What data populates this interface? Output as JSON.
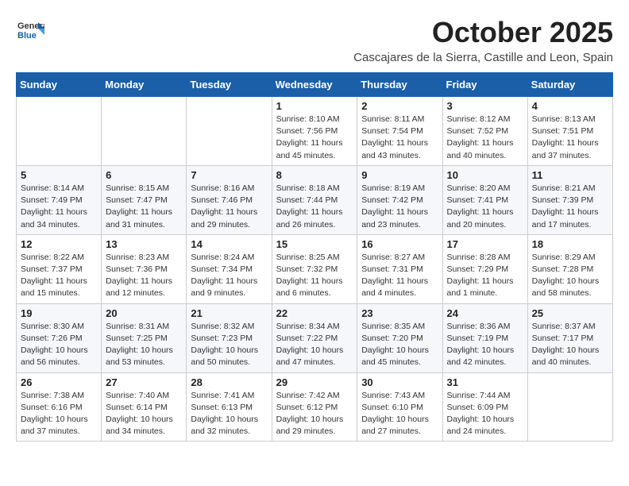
{
  "header": {
    "logo_line1": "General",
    "logo_line2": "Blue",
    "month": "October 2025",
    "location": "Cascajares de la Sierra, Castille and Leon, Spain"
  },
  "weekdays": [
    "Sunday",
    "Monday",
    "Tuesday",
    "Wednesday",
    "Thursday",
    "Friday",
    "Saturday"
  ],
  "weeks": [
    [
      {
        "day": "",
        "info": ""
      },
      {
        "day": "",
        "info": ""
      },
      {
        "day": "",
        "info": ""
      },
      {
        "day": "1",
        "info": "Sunrise: 8:10 AM\nSunset: 7:56 PM\nDaylight: 11 hours and 45 minutes."
      },
      {
        "day": "2",
        "info": "Sunrise: 8:11 AM\nSunset: 7:54 PM\nDaylight: 11 hours and 43 minutes."
      },
      {
        "day": "3",
        "info": "Sunrise: 8:12 AM\nSunset: 7:52 PM\nDaylight: 11 hours and 40 minutes."
      },
      {
        "day": "4",
        "info": "Sunrise: 8:13 AM\nSunset: 7:51 PM\nDaylight: 11 hours and 37 minutes."
      }
    ],
    [
      {
        "day": "5",
        "info": "Sunrise: 8:14 AM\nSunset: 7:49 PM\nDaylight: 11 hours and 34 minutes."
      },
      {
        "day": "6",
        "info": "Sunrise: 8:15 AM\nSunset: 7:47 PM\nDaylight: 11 hours and 31 minutes."
      },
      {
        "day": "7",
        "info": "Sunrise: 8:16 AM\nSunset: 7:46 PM\nDaylight: 11 hours and 29 minutes."
      },
      {
        "day": "8",
        "info": "Sunrise: 8:18 AM\nSunset: 7:44 PM\nDaylight: 11 hours and 26 minutes."
      },
      {
        "day": "9",
        "info": "Sunrise: 8:19 AM\nSunset: 7:42 PM\nDaylight: 11 hours and 23 minutes."
      },
      {
        "day": "10",
        "info": "Sunrise: 8:20 AM\nSunset: 7:41 PM\nDaylight: 11 hours and 20 minutes."
      },
      {
        "day": "11",
        "info": "Sunrise: 8:21 AM\nSunset: 7:39 PM\nDaylight: 11 hours and 17 minutes."
      }
    ],
    [
      {
        "day": "12",
        "info": "Sunrise: 8:22 AM\nSunset: 7:37 PM\nDaylight: 11 hours and 15 minutes."
      },
      {
        "day": "13",
        "info": "Sunrise: 8:23 AM\nSunset: 7:36 PM\nDaylight: 11 hours and 12 minutes."
      },
      {
        "day": "14",
        "info": "Sunrise: 8:24 AM\nSunset: 7:34 PM\nDaylight: 11 hours and 9 minutes."
      },
      {
        "day": "15",
        "info": "Sunrise: 8:25 AM\nSunset: 7:32 PM\nDaylight: 11 hours and 6 minutes."
      },
      {
        "day": "16",
        "info": "Sunrise: 8:27 AM\nSunset: 7:31 PM\nDaylight: 11 hours and 4 minutes."
      },
      {
        "day": "17",
        "info": "Sunrise: 8:28 AM\nSunset: 7:29 PM\nDaylight: 11 hours and 1 minute."
      },
      {
        "day": "18",
        "info": "Sunrise: 8:29 AM\nSunset: 7:28 PM\nDaylight: 10 hours and 58 minutes."
      }
    ],
    [
      {
        "day": "19",
        "info": "Sunrise: 8:30 AM\nSunset: 7:26 PM\nDaylight: 10 hours and 56 minutes."
      },
      {
        "day": "20",
        "info": "Sunrise: 8:31 AM\nSunset: 7:25 PM\nDaylight: 10 hours and 53 minutes."
      },
      {
        "day": "21",
        "info": "Sunrise: 8:32 AM\nSunset: 7:23 PM\nDaylight: 10 hours and 50 minutes."
      },
      {
        "day": "22",
        "info": "Sunrise: 8:34 AM\nSunset: 7:22 PM\nDaylight: 10 hours and 47 minutes."
      },
      {
        "day": "23",
        "info": "Sunrise: 8:35 AM\nSunset: 7:20 PM\nDaylight: 10 hours and 45 minutes."
      },
      {
        "day": "24",
        "info": "Sunrise: 8:36 AM\nSunset: 7:19 PM\nDaylight: 10 hours and 42 minutes."
      },
      {
        "day": "25",
        "info": "Sunrise: 8:37 AM\nSunset: 7:17 PM\nDaylight: 10 hours and 40 minutes."
      }
    ],
    [
      {
        "day": "26",
        "info": "Sunrise: 7:38 AM\nSunset: 6:16 PM\nDaylight: 10 hours and 37 minutes."
      },
      {
        "day": "27",
        "info": "Sunrise: 7:40 AM\nSunset: 6:14 PM\nDaylight: 10 hours and 34 minutes."
      },
      {
        "day": "28",
        "info": "Sunrise: 7:41 AM\nSunset: 6:13 PM\nDaylight: 10 hours and 32 minutes."
      },
      {
        "day": "29",
        "info": "Sunrise: 7:42 AM\nSunset: 6:12 PM\nDaylight: 10 hours and 29 minutes."
      },
      {
        "day": "30",
        "info": "Sunrise: 7:43 AM\nSunset: 6:10 PM\nDaylight: 10 hours and 27 minutes."
      },
      {
        "day": "31",
        "info": "Sunrise: 7:44 AM\nSunset: 6:09 PM\nDaylight: 10 hours and 24 minutes."
      },
      {
        "day": "",
        "info": ""
      }
    ]
  ]
}
